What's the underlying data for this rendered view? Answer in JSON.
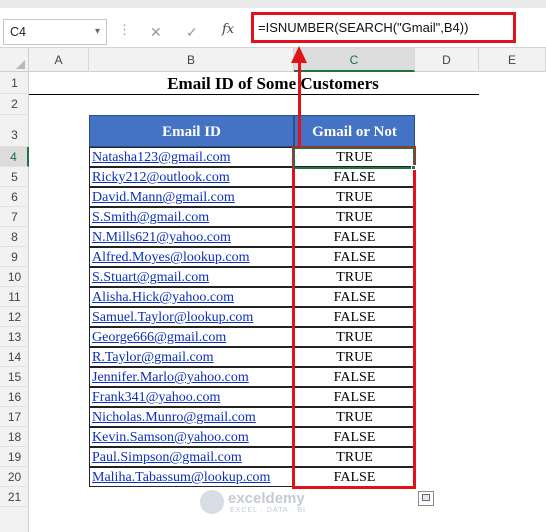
{
  "name_box": {
    "value": "C4",
    "dropdown_icon": "chevron-down-icon"
  },
  "formula_bar": {
    "cancel_icon": "cancel-icon",
    "enter_icon": "check-icon",
    "fx_label": "fx",
    "formula": "=ISNUMBER(SEARCH(\"Gmail\",B4))"
  },
  "columns": [
    "A",
    "B",
    "C",
    "D",
    "E"
  ],
  "rows": [
    "1",
    "2",
    "3",
    "4",
    "5",
    "6",
    "7",
    "8",
    "9",
    "10",
    "11",
    "12",
    "13",
    "14",
    "15",
    "16",
    "17",
    "18",
    "19",
    "20",
    "21"
  ],
  "selected_cell": "C4",
  "sheet": {
    "title": "Email ID of Some Customers",
    "table": {
      "headers": [
        "Email ID",
        "Gmail or Not"
      ],
      "rows": [
        {
          "email": "Natasha123@gmail.com",
          "result": "TRUE"
        },
        {
          "email": "Ricky212@outlook.com",
          "result": "FALSE"
        },
        {
          "email": "David.Mann@gmail.com",
          "result": "TRUE"
        },
        {
          "email": "S.Smith@gmail.com",
          "result": "TRUE"
        },
        {
          "email": "N.Mills621@yahoo.com",
          "result": "FALSE"
        },
        {
          "email": "Alfred.Moyes@lookup.com",
          "result": "FALSE"
        },
        {
          "email": "S.Stuart@gmail.com",
          "result": "TRUE"
        },
        {
          "email": "Alisha.Hick@yahoo.com",
          "result": "FALSE"
        },
        {
          "email": "Samuel.Taylor@lookup.com",
          "result": "FALSE"
        },
        {
          "email": "George666@gmail.com",
          "result": "TRUE"
        },
        {
          "email": "R.Taylor@gmail.com",
          "result": "TRUE"
        },
        {
          "email": "Jennifer.Marlo@yahoo.com",
          "result": "FALSE"
        },
        {
          "email": "Frank341@yahoo.com",
          "result": "FALSE"
        },
        {
          "email": "Nicholas.Munro@gmail.com",
          "result": "TRUE"
        },
        {
          "email": "Kevin.Samson@yahoo.com",
          "result": "FALSE"
        },
        {
          "email": "Paul.Simpson@gmail.com",
          "result": "TRUE"
        },
        {
          "email": "Maliha.Tabassum@lookup.com",
          "result": "FALSE"
        }
      ]
    }
  },
  "watermark": {
    "name": "exceldemy",
    "tagline": "EXCEL · DATA · BI"
  },
  "colors": {
    "header_fill": "#4472c4",
    "highlight": "#e2121b",
    "selection": "#217346",
    "link": "#0b2fbf"
  }
}
